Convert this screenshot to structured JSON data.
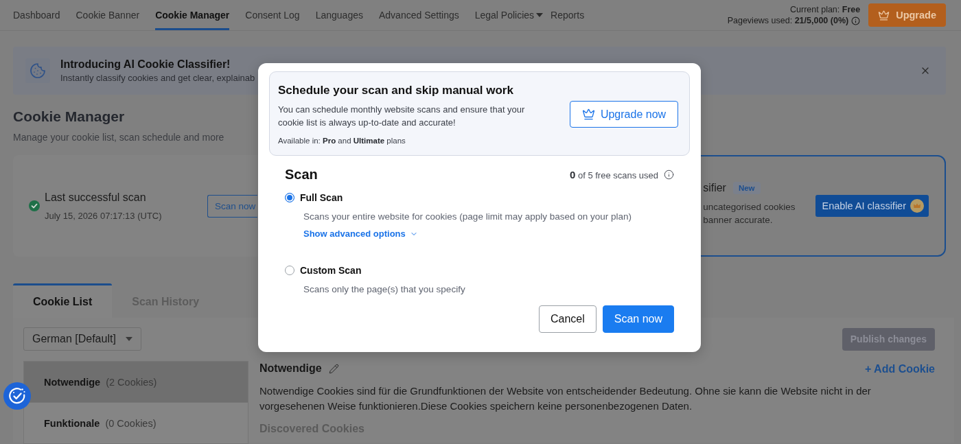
{
  "nav": {
    "tabs": [
      {
        "label": "Dashboard",
        "selected": false,
        "kind": "link"
      },
      {
        "label": "Cookie Banner",
        "selected": false,
        "kind": "link"
      },
      {
        "label": "Cookie Manager",
        "selected": true,
        "kind": "link"
      },
      {
        "label": "Consent Log",
        "selected": false,
        "kind": "link"
      },
      {
        "label": "Languages",
        "selected": false,
        "kind": "link"
      },
      {
        "label": "Advanced Settings",
        "selected": false,
        "kind": "link"
      },
      {
        "label": "Legal Policies",
        "selected": false,
        "kind": "menu"
      },
      {
        "label": "Reports",
        "selected": false,
        "kind": "link"
      }
    ],
    "plan": "Current plan: **Free**",
    "pageviews": "Pageviews used: **21/5,000 (0%)**",
    "upgrade_button": "Upgrade"
  },
  "announcement": {
    "title": "Introducing AI Cookie Classifier!",
    "text": "Instantly classify cookies and get clear, explainab"
  },
  "page": {
    "title": "Cookie Manager",
    "subtitle": "Manage your cookie list, scan schedule and more"
  },
  "last_scan": {
    "title": "Last successful scan",
    "date": "July 15, 2026 07:17:13 (UTC)",
    "button": "Scan now"
  },
  "ai_classifier": {
    "title": "sifier",
    "badge": "New",
    "lines": [
      "uncategorised cookies",
      "banner accurate."
    ],
    "button": "Enable AI classifier"
  },
  "tabs": [
    {
      "label": "Cookie List",
      "selected": true
    },
    {
      "label": "Scan History",
      "selected": false
    }
  ],
  "language_select": {
    "value": "German [Default]"
  },
  "publish_button": {
    "label": "Publish changes",
    "disabled": true
  },
  "categories": [
    {
      "name": "Notwendige",
      "count": "(2 Cookies)",
      "selected": true
    },
    {
      "name": "Funktionale",
      "count": "(0 Cookies)",
      "selected": false
    }
  ],
  "category_detail": {
    "title": "Notwendige",
    "add_button": "+ Add Cookie",
    "description": "Notwendige Cookies sind für die Grundfunktionen der Website von entscheidender Bedeutung. Ohne sie kann die Website nicht in der vorgesehenen Weise funktionieren.Diese Cookies speichern keine personenbezogenen Daten.",
    "section_title": "Discovered Cookies"
  },
  "modal": {
    "promo": {
      "title": "Schedule your scan and skip manual work",
      "text": "You can schedule monthly website scans and ensure that your cookie list is always up-to-date and accurate!",
      "availability": "Available in: **Pro** and **Ultimate** plans",
      "button": "Upgrade now"
    },
    "scan": {
      "title": "Scan",
      "usage": "**0** of 5 free scans used",
      "options": [
        {
          "label": "Full Scan",
          "description": "Scans your entire website for cookies (page limit may apply based on your plan)",
          "selected": true,
          "link": "Show advanced options"
        },
        {
          "label": "Custom Scan",
          "description": "Scans only the page(s) that you specify",
          "selected": false
        }
      ],
      "buttons": [
        {
          "label": "Cancel",
          "kind": "secondary"
        },
        {
          "label": "Scan now",
          "kind": "primary"
        }
      ]
    }
  }
}
